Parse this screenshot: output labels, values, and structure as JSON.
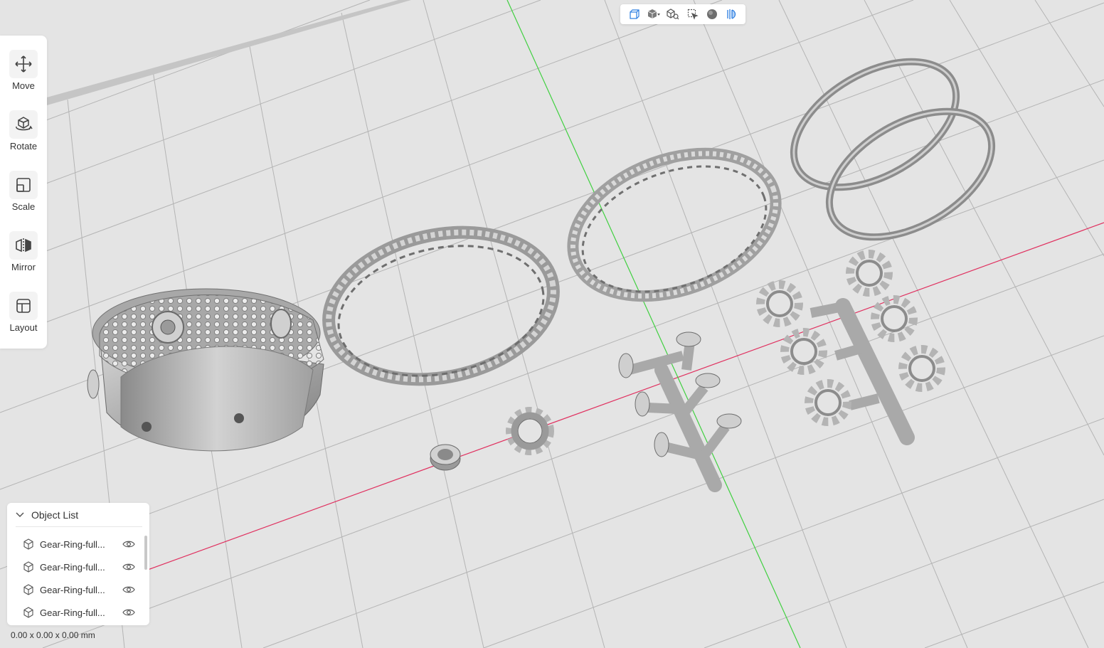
{
  "viewport": {
    "background": "#e4e4e4",
    "grid_color": "#b4b4b4",
    "x_axis_color": "#e0305f",
    "y_axis_color": "#40d040",
    "model_color": "#bdbdbd"
  },
  "view_toolbar": {
    "buttons": [
      {
        "icon": "wireframe-cube-icon",
        "active": true
      },
      {
        "icon": "solid-cube-dropdown-icon"
      },
      {
        "icon": "cube-search-icon"
      },
      {
        "icon": "select-cursor-icon"
      },
      {
        "icon": "sphere-shading-icon"
      },
      {
        "icon": "layers-icon",
        "active": true
      }
    ]
  },
  "tools": [
    {
      "label": "Move",
      "icon": "move-icon"
    },
    {
      "label": "Rotate",
      "icon": "rotate-icon"
    },
    {
      "label": "Scale",
      "icon": "scale-icon"
    },
    {
      "label": "Mirror",
      "icon": "mirror-icon"
    },
    {
      "label": "Layout",
      "icon": "layout-icon"
    }
  ],
  "object_list": {
    "title": "Object List",
    "items": [
      {
        "name": "Gear-Ring-full..."
      },
      {
        "name": "Gear-Ring-full..."
      },
      {
        "name": "Gear-Ring-full..."
      },
      {
        "name": "Gear-Ring-full..."
      }
    ]
  },
  "dimensions": "0.00 x 0.00 x 0.00 mm"
}
